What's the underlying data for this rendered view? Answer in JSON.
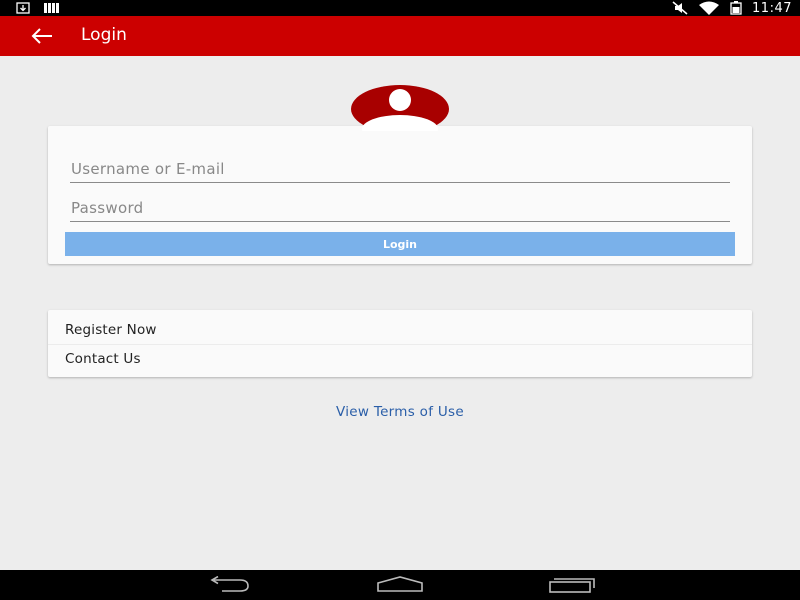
{
  "status_bar": {
    "time": "11:47",
    "left_icons": [
      "download-icon",
      "bars-icon"
    ],
    "right_icons": [
      "mute-icon",
      "wifi-icon",
      "battery-icon"
    ]
  },
  "app_bar": {
    "title": "Login",
    "back_icon": "arrow-left-icon",
    "color": "#cc0000"
  },
  "avatar": {
    "icon": "user-avatar-icon",
    "color": "#a80000"
  },
  "login_form": {
    "username_placeholder": "Username or E-mail",
    "password_placeholder": "Password",
    "login_label": "Login",
    "button_color": "#7ab1ea"
  },
  "links": {
    "items": [
      {
        "label": "Register Now"
      },
      {
        "label": "Contact Us"
      }
    ]
  },
  "terms_label": "View Terms of Use",
  "nav_bar": {
    "icons": [
      "nav-back-icon",
      "nav-home-icon",
      "nav-recents-icon"
    ]
  }
}
